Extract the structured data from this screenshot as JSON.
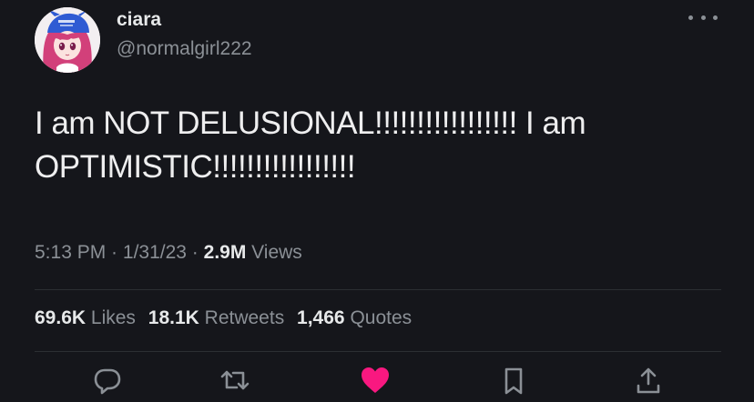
{
  "author": {
    "name": "ciara",
    "handle": "@normalgirl222",
    "avatar_icon": "anime-girl-avatar"
  },
  "tweet": {
    "text": "I am NOT DELUSIONAL!!!!!!!!!!!!!!!!! I am OPTIMISTIC!!!!!!!!!!!!!!!!!"
  },
  "meta": {
    "time": "5:13 PM",
    "sep1": " · ",
    "date": "1/31/23",
    "sep2": " · ",
    "views_count": "2.9M",
    "views_label": "Views"
  },
  "stats": {
    "likes_count": "69.6K",
    "likes_label": "Likes",
    "retweets_count": "18.1K",
    "retweets_label": "Retweets",
    "quotes_count": "1,466",
    "quotes_label": "Quotes"
  },
  "actions": [
    {
      "icon": "reply-icon"
    },
    {
      "icon": "retweet-icon"
    },
    {
      "icon": "heart-icon",
      "color": "#f91880"
    },
    {
      "icon": "bookmark-icon"
    },
    {
      "icon": "share-icon"
    }
  ],
  "colors": {
    "background": "#15161b",
    "primary_text": "#e7e9ea",
    "secondary_text": "#8b9096",
    "like_active": "#f91880"
  }
}
